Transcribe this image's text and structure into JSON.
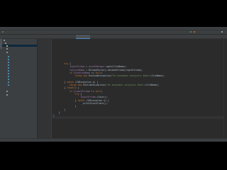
{
  "colors": {
    "keyword": "#cc7832",
    "field": "#9876aa",
    "string": "#6a8759",
    "plain": "#a9b7c6",
    "background": "#2b2b2b",
    "panel": "#3c3f41"
  },
  "editor": {
    "lines": [
      {
        "indent": 2,
        "tokens": [
          [
            "kw",
            "try"
          ],
          [
            "pl",
            " {"
          ]
        ]
      },
      {
        "indent": 3,
        "tokens": [
          [
            "fld",
            "inputStream"
          ],
          [
            "pl",
            " = "
          ],
          [
            "fld",
            "assetManager"
          ],
          [
            "pl",
            ".open(fileName);"
          ]
        ]
      },
      {
        "indent": 3,
        "tokens": [
          [
            "fld",
            "textureName"
          ],
          [
            "pl",
            " = "
          ],
          [
            "pl",
            "BitmapFactory.decodeStream(inputStream);"
          ]
        ]
      },
      {
        "indent": 3,
        "tokens": [
          [
            "kw",
            "if"
          ],
          [
            "pl",
            " ("
          ],
          [
            "fld",
            "textureName"
          ],
          [
            "pl",
            " == "
          ],
          [
            "kw",
            "null"
          ],
          [
            "pl",
            ")"
          ]
        ]
      },
      {
        "indent": 4,
        "tokens": [
          [
            "kw",
            "throw new"
          ],
          [
            "pl",
            " RuntimeException("
          ],
          [
            "str",
            "\"Не возможно загрузить файл\""
          ],
          [
            "pl",
            "+fileName);"
          ]
        ]
      },
      {
        "indent": 0,
        "tokens": []
      },
      {
        "indent": 2,
        "tokens": [
          [
            "pl",
            "} "
          ],
          [
            "kw",
            "catch"
          ],
          [
            "pl",
            " (IOException e) {"
          ]
        ]
      },
      {
        "indent": 3,
        "tokens": [
          [
            "kw",
            "throw new"
          ],
          [
            "pl",
            " RuntimeException("
          ],
          [
            "str",
            "\"Не возможно загрузить файл\""
          ],
          [
            "pl",
            "+fileName);"
          ]
        ]
      },
      {
        "indent": 2,
        "tokens": [
          [
            "pl",
            "} "
          ],
          [
            "kw",
            "finally"
          ],
          [
            "pl",
            " {"
          ]
        ]
      },
      {
        "indent": 3,
        "tokens": [
          [
            "kw",
            "if"
          ],
          [
            "pl",
            " ("
          ],
          [
            "fld",
            "inputStream"
          ],
          [
            "pl",
            " != "
          ],
          [
            "kw",
            "null"
          ],
          [
            "pl",
            ")"
          ]
        ]
      },
      {
        "indent": 4,
        "tokens": [
          [
            "kw",
            "try"
          ],
          [
            "pl",
            " {"
          ]
        ]
      },
      {
        "indent": 5,
        "tokens": [
          [
            "fld",
            "inputStream"
          ],
          [
            "pl",
            ".close();"
          ]
        ]
      },
      {
        "indent": 4,
        "tokens": [
          [
            "pl",
            "} "
          ],
          [
            "kw",
            "catch"
          ],
          [
            "pl",
            " (IOException e) {"
          ]
        ]
      },
      {
        "indent": 5,
        "tokens": [
          [
            "hl",
            "e"
          ],
          [
            "pl",
            ".printStackTrace();"
          ]
        ]
      },
      {
        "indent": 4,
        "tokens": [
          [
            "pl",
            "}"
          ]
        ]
      },
      {
        "indent": 2,
        "tokens": [
          [
            "pl",
            "}"
          ]
        ]
      },
      {
        "indent": 1,
        "tokens": [
          [
            "pl",
            "}"
          ]
        ]
      },
      {
        "indent": 0,
        "tokens": [
          [
            "pl",
            "}"
          ]
        ]
      }
    ]
  }
}
